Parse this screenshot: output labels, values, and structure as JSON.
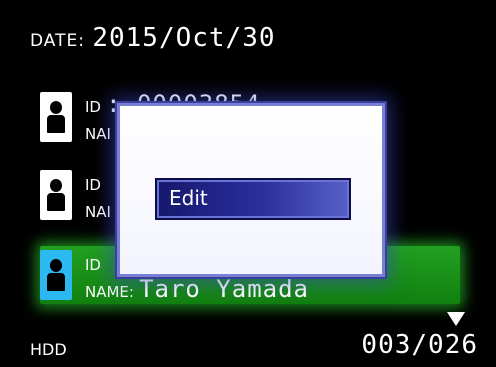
{
  "header": {
    "date_key": "DATE:",
    "date_value": "2015/Oct/30"
  },
  "entries": [
    {
      "id_label": "ID",
      "id_value": ": 00003854",
      "name_label": "NAI",
      "name_value": "",
      "selected": false
    },
    {
      "id_label": "ID",
      "id_value": "",
      "name_label": "NAI",
      "name_value": "",
      "selected": false
    },
    {
      "id_label": "ID",
      "id_value": "",
      "name_label": "NAME:",
      "name_value": "Taro Yamada",
      "selected": true
    }
  ],
  "modal": {
    "edit_label": "Edit"
  },
  "footer": {
    "storage": "HDD",
    "page_counter": "003/026"
  },
  "icons": {
    "person": "person-icon",
    "scroll": "triangle-down-icon"
  },
  "colors": {
    "selected_highlight": "#22a020",
    "selected_icon": "#2cb8f0",
    "modal_border": "#7a7fd6",
    "button_fill": "#2a2f9c"
  }
}
